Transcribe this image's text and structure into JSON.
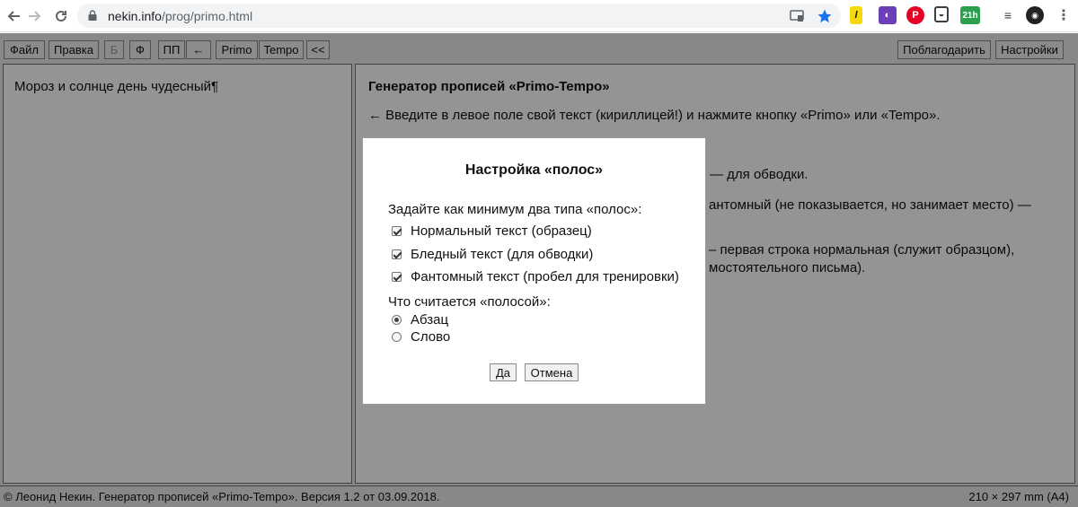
{
  "browser": {
    "url_domain": "nekin.info",
    "url_path": "/prog/primo.html",
    "icons": [
      "back-arrow-icon",
      "forward-arrow-icon",
      "reload-icon",
      "lock-icon",
      "cast-icon",
      "bookmark-star-icon"
    ],
    "extension_21h_label": "21h"
  },
  "toolbar": {
    "file": "Файл",
    "edit": "Правка",
    "b": "Б",
    "f": "Ф",
    "pp": "ПП",
    "arrow": "←",
    "primo": "Primo",
    "tempo": "Tempo",
    "collapse": "<<",
    "thanks": "Поблагодарить",
    "settings": "Настройки"
  },
  "left_panel": {
    "text": "Мороз и солнце день чудесный¶"
  },
  "right_panel": {
    "title": "Генератор прописей «Primo-Tempo»",
    "line1": "← Введите в левое поле свой текст (кириллицей!) и нажмите кнопку «Primo» или «Tempo».",
    "line2_fragment": "— для обводки.",
    "line3_fragment": "антомный (не показывается, но занимает место) —",
    "line4_fragment": "– первая строка нормальная (служит образцом),",
    "line5_fragment": "мостоятельного письма)."
  },
  "status": {
    "left": "© Леонид Некин. Генератор прописей «Primo-Tempo». Версия 1.2 от 03.09.2018.",
    "right": "210 × 297 mm (A4)"
  },
  "dialog": {
    "title": "Настройка «полос»",
    "intro": "Задайте как минимум два типа «полос»:",
    "checkboxes": [
      {
        "label": "Нормальный текст (образец)",
        "checked": true
      },
      {
        "label": "Бледный текст (для обводки)",
        "checked": true
      },
      {
        "label": "Фантомный текст (пробел для тренировки)",
        "checked": true
      }
    ],
    "question": "Что считается «полосой»:",
    "radios": [
      {
        "label": "Абзац",
        "checked": true
      },
      {
        "label": "Слово",
        "checked": false
      }
    ],
    "ok": "Да",
    "cancel": "Отмена"
  }
}
